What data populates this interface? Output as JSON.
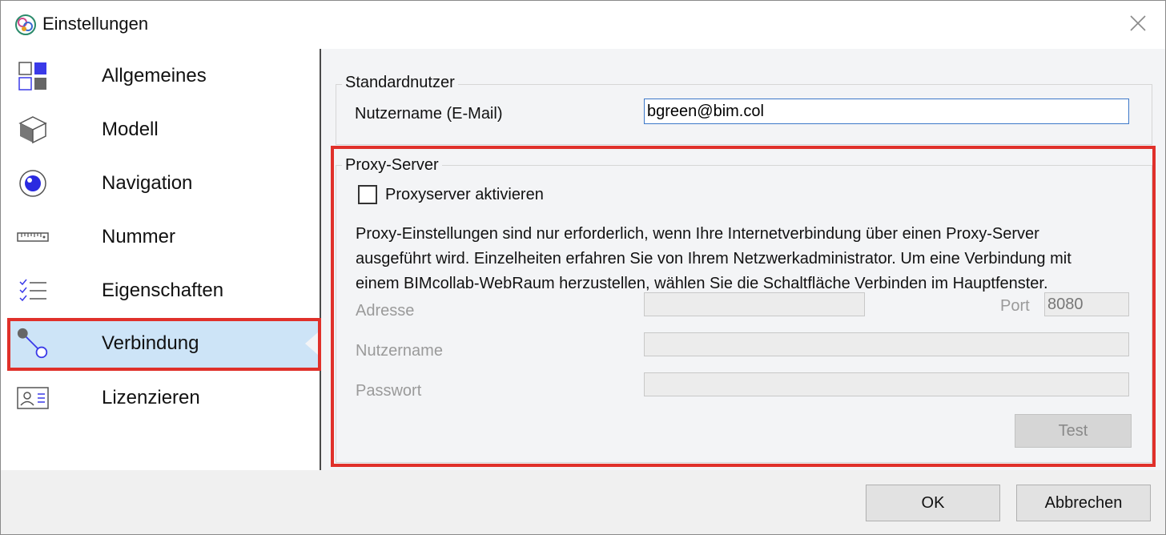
{
  "window": {
    "title": "Einstellungen",
    "app_icon": "bimcollab-app-icon",
    "close_icon": "close-icon"
  },
  "sidebar": {
    "items": [
      {
        "label": "Allgemeines",
        "icon": "grid-tiles-icon",
        "active": false
      },
      {
        "label": "Modell",
        "icon": "cube-icon",
        "active": false
      },
      {
        "label": "Navigation",
        "icon": "eye-target-icon",
        "active": false
      },
      {
        "label": "Nummer",
        "icon": "ruler-icon",
        "active": false
      },
      {
        "label": "Eigenschaften",
        "icon": "checklist-icon",
        "active": false
      },
      {
        "label": "Verbindung",
        "icon": "connection-icon",
        "active": true
      },
      {
        "label": "Lizenzieren",
        "icon": "id-card-icon",
        "active": false
      }
    ]
  },
  "standard_user": {
    "legend": "Standardnutzer",
    "username_label": "Nutzername (E-Mail)",
    "username_value": "bgreen@bim.col"
  },
  "proxy": {
    "legend": "Proxy-Server",
    "enable_label": "Proxyserver aktivieren",
    "enabled": false,
    "info": "Proxy-Einstellungen sind nur erforderlich, wenn Ihre Internetverbindung über einen Proxy-Server ausgeführt wird. Einzelheiten erfahren Sie von Ihrem Netzwerkadministrator. Um eine Verbindung mit einem BIMcollab-WebRaum herzustellen, wählen Sie die Schaltfläche Verbinden im Hauptfenster.",
    "address_label": "Adresse",
    "address_value": "",
    "port_label": "Port",
    "port_value": "8080",
    "username_label": "Nutzername",
    "username_value": "",
    "password_label": "Passwort",
    "password_value": "",
    "test_label": "Test"
  },
  "footer": {
    "ok_label": "OK",
    "cancel_label": "Abbrechen"
  },
  "colors": {
    "highlight": "#e0302a",
    "active_bg": "#cde4f7",
    "accent_blue": "#3a3ae8"
  }
}
